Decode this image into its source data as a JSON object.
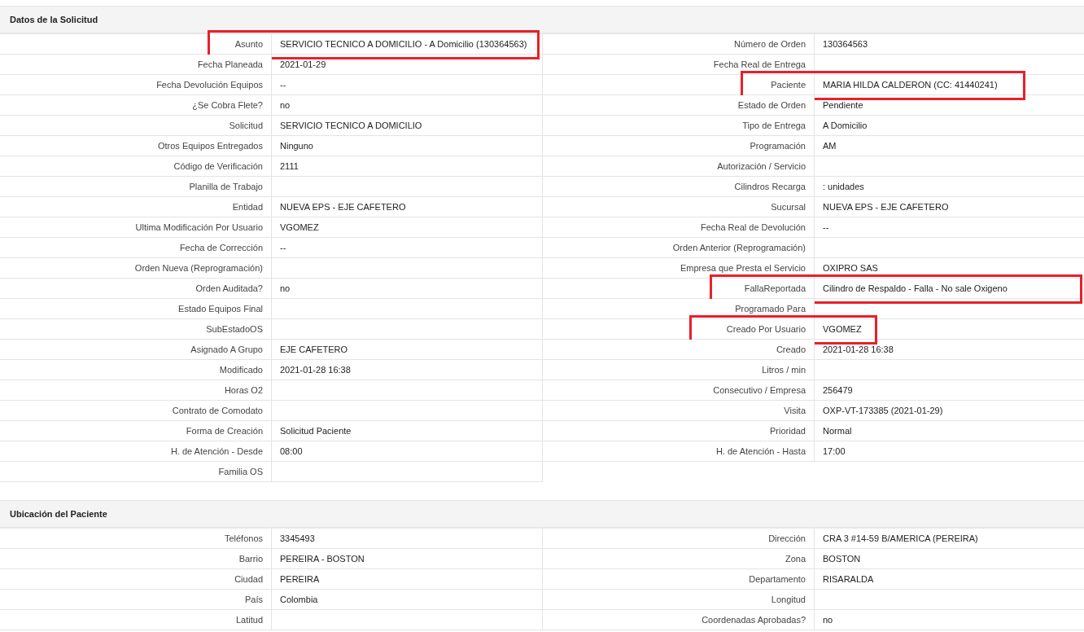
{
  "sections": [
    {
      "title": "Datos de la Solicitud",
      "left": [
        {
          "label": "Asunto",
          "value": "SERVICIO TECNICO A DOMICILIO - A Domicilio (130364563)",
          "highlighted": true
        },
        {
          "label": "Fecha Planeada",
          "value": "2021-01-29"
        },
        {
          "label": "Fecha Devolución Equipos",
          "value": "--"
        },
        {
          "label": "¿Se Cobra Flete?",
          "value": "no"
        },
        {
          "label": "Solicitud",
          "value": "SERVICIO TECNICO A DOMICILIO"
        },
        {
          "label": "Otros Equipos Entregados",
          "value": "Ninguno"
        },
        {
          "label": "Código de Verificación",
          "value": "2111"
        },
        {
          "label": "Planilla de Trabajo"
        },
        {
          "label": "Entidad",
          "value": "NUEVA EPS - EJE CAFETERO"
        },
        {
          "label": "Ultima Modificación Por Usuario",
          "value": "VGOMEZ"
        },
        {
          "label": "Fecha de Corrección",
          "value": "--"
        },
        {
          "label": "Orden Nueva (Reprogramación)"
        },
        {
          "label": "Orden Auditada?",
          "value": "no"
        },
        {
          "label": "Estado Equipos Final"
        },
        {
          "label": "SubEstadoOS"
        },
        {
          "label": "Asignado A Grupo",
          "value": "EJE CAFETERO"
        },
        {
          "label": "Modificado",
          "value": "2021-01-28 16:38"
        },
        {
          "label": "Horas O2"
        },
        {
          "label": "Contrato de Comodato"
        },
        {
          "label": "Forma de Creación",
          "value": "Solicitud Paciente"
        },
        {
          "label": "H. de Atención - Desde",
          "value": "08:00"
        },
        {
          "label": "Familia OS"
        }
      ],
      "right": [
        {
          "label": "Número de Orden",
          "value": "130364563"
        },
        {
          "label": "Fecha Real de Entrega"
        },
        {
          "label": "Paciente",
          "value": "MARIA HILDA CALDERON (CC: 41440241)",
          "highlighted": true
        },
        {
          "label": "Estado de Orden",
          "value": "Pendiente"
        },
        {
          "label": "Tipo de Entrega",
          "value": "A Domicilio"
        },
        {
          "label": "Programación",
          "value": "AM"
        },
        {
          "label": "Autorización / Servicio"
        },
        {
          "label": "Cilindros Recarga",
          "value": ": unidades"
        },
        {
          "label": "Sucursal",
          "value": "NUEVA EPS - EJE CAFETERO"
        },
        {
          "label": "Fecha Real de Devolución",
          "value": "--"
        },
        {
          "label": "Orden Anterior (Reprogramación)"
        },
        {
          "label": "Empresa que Presta el Servicio",
          "value": "OXIPRO SAS"
        },
        {
          "label": "FallaReportada",
          "value": "Cilindro de Respaldo - Falla - No sale Oxigeno",
          "highlighted": true
        },
        {
          "label": "Programado Para"
        },
        {
          "label": "Creado Por Usuario",
          "value": "VGOMEZ",
          "highlighted": true
        },
        {
          "label": "Creado",
          "value": "2021-01-28 16:38"
        },
        {
          "label": "Litros / min"
        },
        {
          "label": "Consecutivo / Empresa",
          "value": "256479"
        },
        {
          "label": "Visita",
          "value": "OXP-VT-173385 (2021-01-29)"
        },
        {
          "label": "Prioridad",
          "value": "Normal"
        },
        {
          "label": "H. de Atención - Hasta",
          "value": "17:00"
        }
      ]
    },
    {
      "title": "Ubicación del Paciente",
      "left": [
        {
          "label": "Teléfonos",
          "value": "3345493"
        },
        {
          "label": "Barrio",
          "value": "PEREIRA - BOSTON"
        },
        {
          "label": "Ciudad",
          "value": "PEREIRA"
        },
        {
          "label": "País",
          "value": "Colombia"
        },
        {
          "label": "Latitud"
        }
      ],
      "right": [
        {
          "label": "Dirección",
          "value": "CRA 3 #14-59 B/AMERICA (PEREIRA)"
        },
        {
          "label": "Zona",
          "value": "BOSTON"
        },
        {
          "label": "Departamento",
          "value": "RISARALDA"
        },
        {
          "label": "Longitud"
        },
        {
          "label": "Coordenadas Aprobadas?",
          "value": "no"
        }
      ]
    }
  ]
}
